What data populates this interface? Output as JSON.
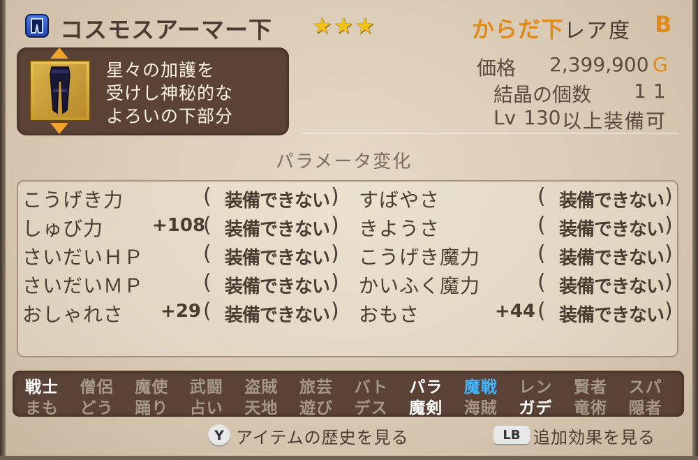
{
  "header": {
    "item_name": "コスモスアーマー下",
    "stars": "★★★",
    "slot": "からだ下",
    "rarity_label": "レア度",
    "rarity_value": "B"
  },
  "description": [
    "星々の加護を",
    "受けし神秘的な",
    "よろいの下部分"
  ],
  "info": {
    "price_label": "価格",
    "price_value": "2,399,900",
    "price_unit": "G",
    "crystal_label": "結晶の個数",
    "crystal_value": "11",
    "lv_prefix": "Lv",
    "lv_value": "130",
    "lv_suffix": "以上装備可"
  },
  "params": {
    "title": "パラメータ変化",
    "rows": [
      {
        "left_name": "こうげき力",
        "left_bonus": "",
        "left_status": "装備できない",
        "right_name": "すばやさ",
        "right_bonus": "",
        "right_status": "装備できない"
      },
      {
        "left_name": "しゅび力",
        "left_bonus": "+108",
        "left_status": "装備できない",
        "right_name": "きようさ",
        "right_bonus": "",
        "right_status": "装備できない"
      },
      {
        "left_name": "さいだいＨＰ",
        "left_bonus": "",
        "left_status": "装備できない",
        "right_name": "こうげき魔力",
        "right_bonus": "",
        "right_status": "装備できない"
      },
      {
        "left_name": "さいだいＭＰ",
        "left_bonus": "",
        "left_status": "装備できない",
        "right_name": "かいふく魔力",
        "right_bonus": "",
        "right_status": "装備できない"
      },
      {
        "left_name": "おしゃれさ",
        "left_bonus": "+29",
        "left_status": "装備できない",
        "right_name": "おもさ",
        "right_bonus": "+44",
        "right_status": "装備できない"
      }
    ]
  },
  "jobs": {
    "row1": [
      {
        "label": "戦士",
        "state": "on"
      },
      {
        "label": "僧侶",
        "state": "off"
      },
      {
        "label": "魔使",
        "state": "off"
      },
      {
        "label": "武闘",
        "state": "off"
      },
      {
        "label": "盗賊",
        "state": "off"
      },
      {
        "label": "旅芸",
        "state": "off"
      },
      {
        "label": "バト",
        "state": "off"
      },
      {
        "label": "パラ",
        "state": "on"
      },
      {
        "label": "魔戦",
        "state": "hi"
      },
      {
        "label": "レン",
        "state": "off"
      },
      {
        "label": "賢者",
        "state": "off"
      },
      {
        "label": "スパ",
        "state": "off"
      }
    ],
    "row2": [
      {
        "label": "まも",
        "state": "off"
      },
      {
        "label": "どう",
        "state": "off"
      },
      {
        "label": "踊り",
        "state": "off"
      },
      {
        "label": "占い",
        "state": "off"
      },
      {
        "label": "天地",
        "state": "off"
      },
      {
        "label": "遊び",
        "state": "off"
      },
      {
        "label": "デス",
        "state": "off"
      },
      {
        "label": "魔剣",
        "state": "on"
      },
      {
        "label": "海賊",
        "state": "off"
      },
      {
        "label": "ガデ",
        "state": "on"
      },
      {
        "label": "竜術",
        "state": "off"
      },
      {
        "label": "隠者",
        "state": "off"
      }
    ]
  },
  "footer": {
    "history_button": "Y",
    "history_label": "アイテムの歴史を見る",
    "effects_button": "LB",
    "effects_label": "追加効果を見る"
  },
  "colors": {
    "accent": "#e08a1a",
    "highlight_job": "#42b6ff",
    "panel": "#5a4236"
  }
}
